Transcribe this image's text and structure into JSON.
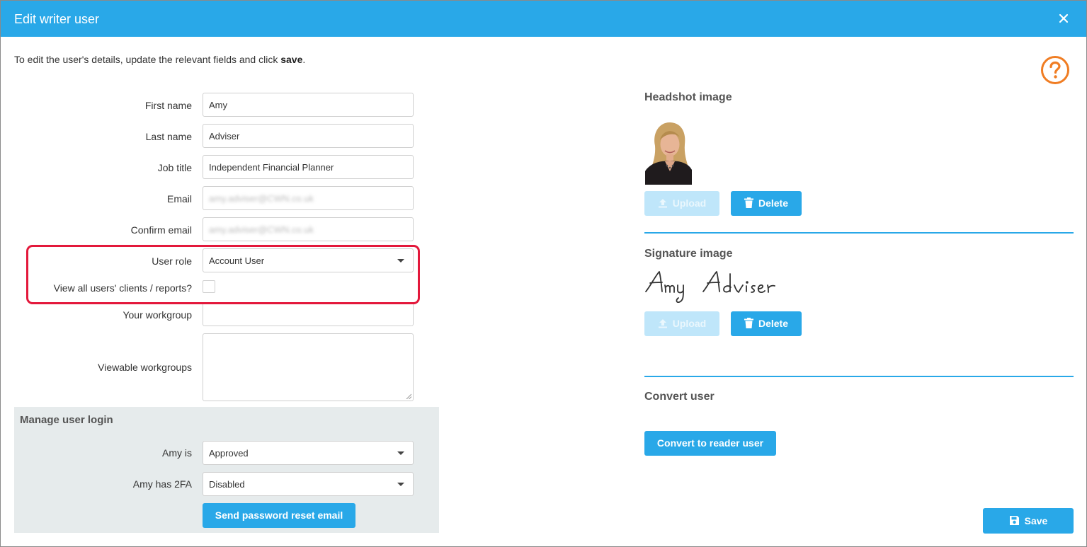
{
  "dialog": {
    "title": "Edit writer user",
    "intro_text": "To edit the user's details, update the relevant fields and click ",
    "intro_bold": "save",
    "intro_end": "."
  },
  "form": {
    "first_name": {
      "label": "First name",
      "value": "Amy"
    },
    "last_name": {
      "label": "Last name",
      "value": "Adviser"
    },
    "job_title": {
      "label": "Job title",
      "value": "Independent Financial Planner"
    },
    "email": {
      "label": "Email",
      "value": "amy.adviser@CWN.co.uk"
    },
    "confirm_email": {
      "label": "Confirm email",
      "value": "amy.adviser@CWN.co.uk"
    },
    "user_role": {
      "label": "User role",
      "value": "Account User"
    },
    "view_all": {
      "label": "View all users' clients / reports?",
      "checked": false
    },
    "workgroup": {
      "label": "Your workgroup",
      "value": ""
    },
    "viewable_workgroups": {
      "label": "Viewable workgroups",
      "value": ""
    }
  },
  "manage_login": {
    "title": "Manage user login",
    "status": {
      "label": "Amy is",
      "value": "Approved"
    },
    "twofa": {
      "label": "Amy has 2FA",
      "value": "Disabled"
    },
    "reset_button": "Send password reset email"
  },
  "headshot": {
    "title": "Headshot image",
    "upload_label": "Upload",
    "delete_label": "Delete"
  },
  "signature": {
    "title": "Signature image",
    "upload_label": "Upload",
    "delete_label": "Delete"
  },
  "convert": {
    "title": "Convert user",
    "button": "Convert to reader user"
  },
  "save_label": "Save",
  "colors": {
    "header": "#29a8e8",
    "accent": "#29a8e8",
    "highlight": "#e3183b",
    "help": "#f07d23",
    "panel": "#e6ebec"
  },
  "icons": [
    "close-icon",
    "help-icon",
    "upload-icon",
    "trash-icon",
    "save-icon",
    "caret-down-icon"
  ]
}
